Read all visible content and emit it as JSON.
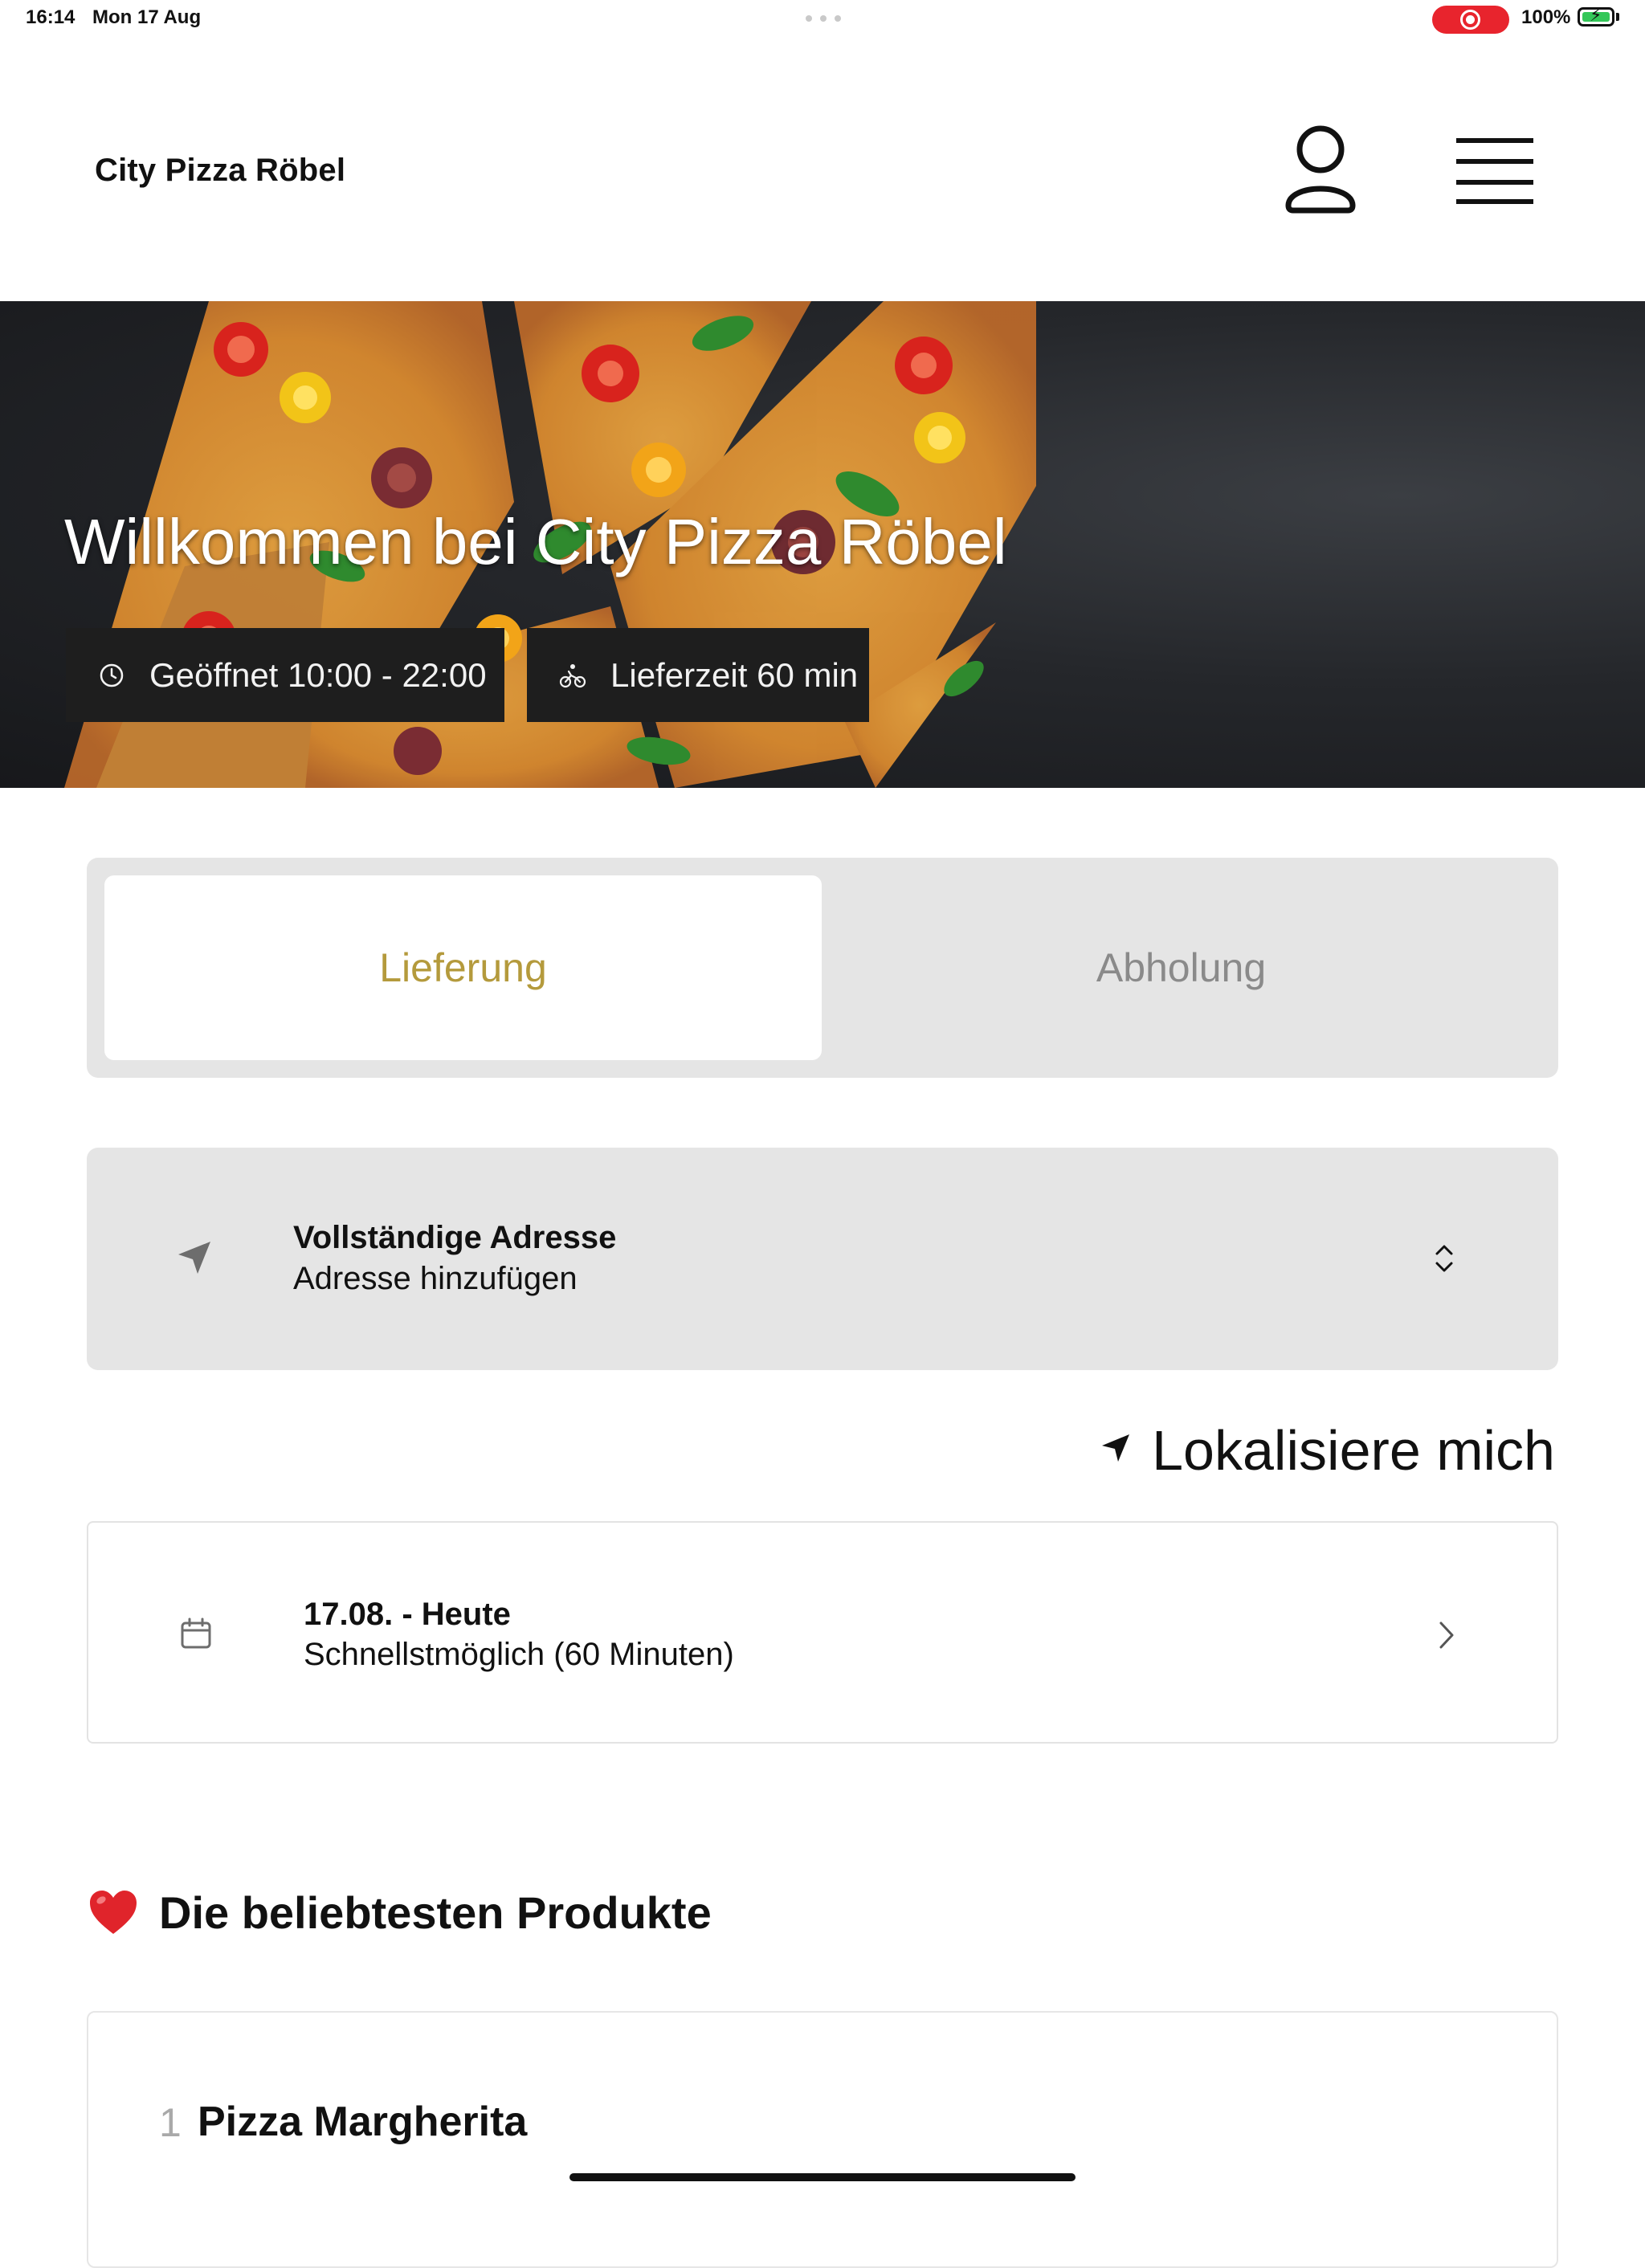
{
  "status_bar": {
    "time": "16:14",
    "date": "Mon 17 Aug",
    "battery": "100%",
    "recording_color": "#e8242d",
    "battery_color": "#34c759"
  },
  "header": {
    "title": "City Pizza Röbel",
    "account_icon": "user-icon",
    "menu_icon": "hamburger-menu-icon"
  },
  "hero": {
    "title": "Willkommen bei City Pizza Röbel",
    "opening_hours": "Geöffnet 10:00 - 22:00",
    "delivery_time": "Lieferzeit 60 min",
    "opening_icon": "clock-icon",
    "delivery_icon": "bicycle-icon"
  },
  "order_mode": {
    "options": [
      "Lieferung",
      "Abholung"
    ],
    "selected": "Lieferung",
    "accent_color": "#b49a3c"
  },
  "address": {
    "label": "Vollständige Adresse",
    "value": "Adresse hinzufügen",
    "icon": "navigation-arrow-icon"
  },
  "locate": {
    "label": "Lokalisiere mich",
    "icon": "location-arrow-icon"
  },
  "schedule": {
    "label": "17.08. - Heute",
    "value": "Schnellstmöglich (60 Minuten)",
    "icon": "calendar-icon"
  },
  "popular": {
    "heading": "Die beliebtesten Produkte",
    "icon": "heart-icon",
    "products": [
      {
        "rank": "1",
        "name": "Pizza Margherita"
      }
    ]
  }
}
